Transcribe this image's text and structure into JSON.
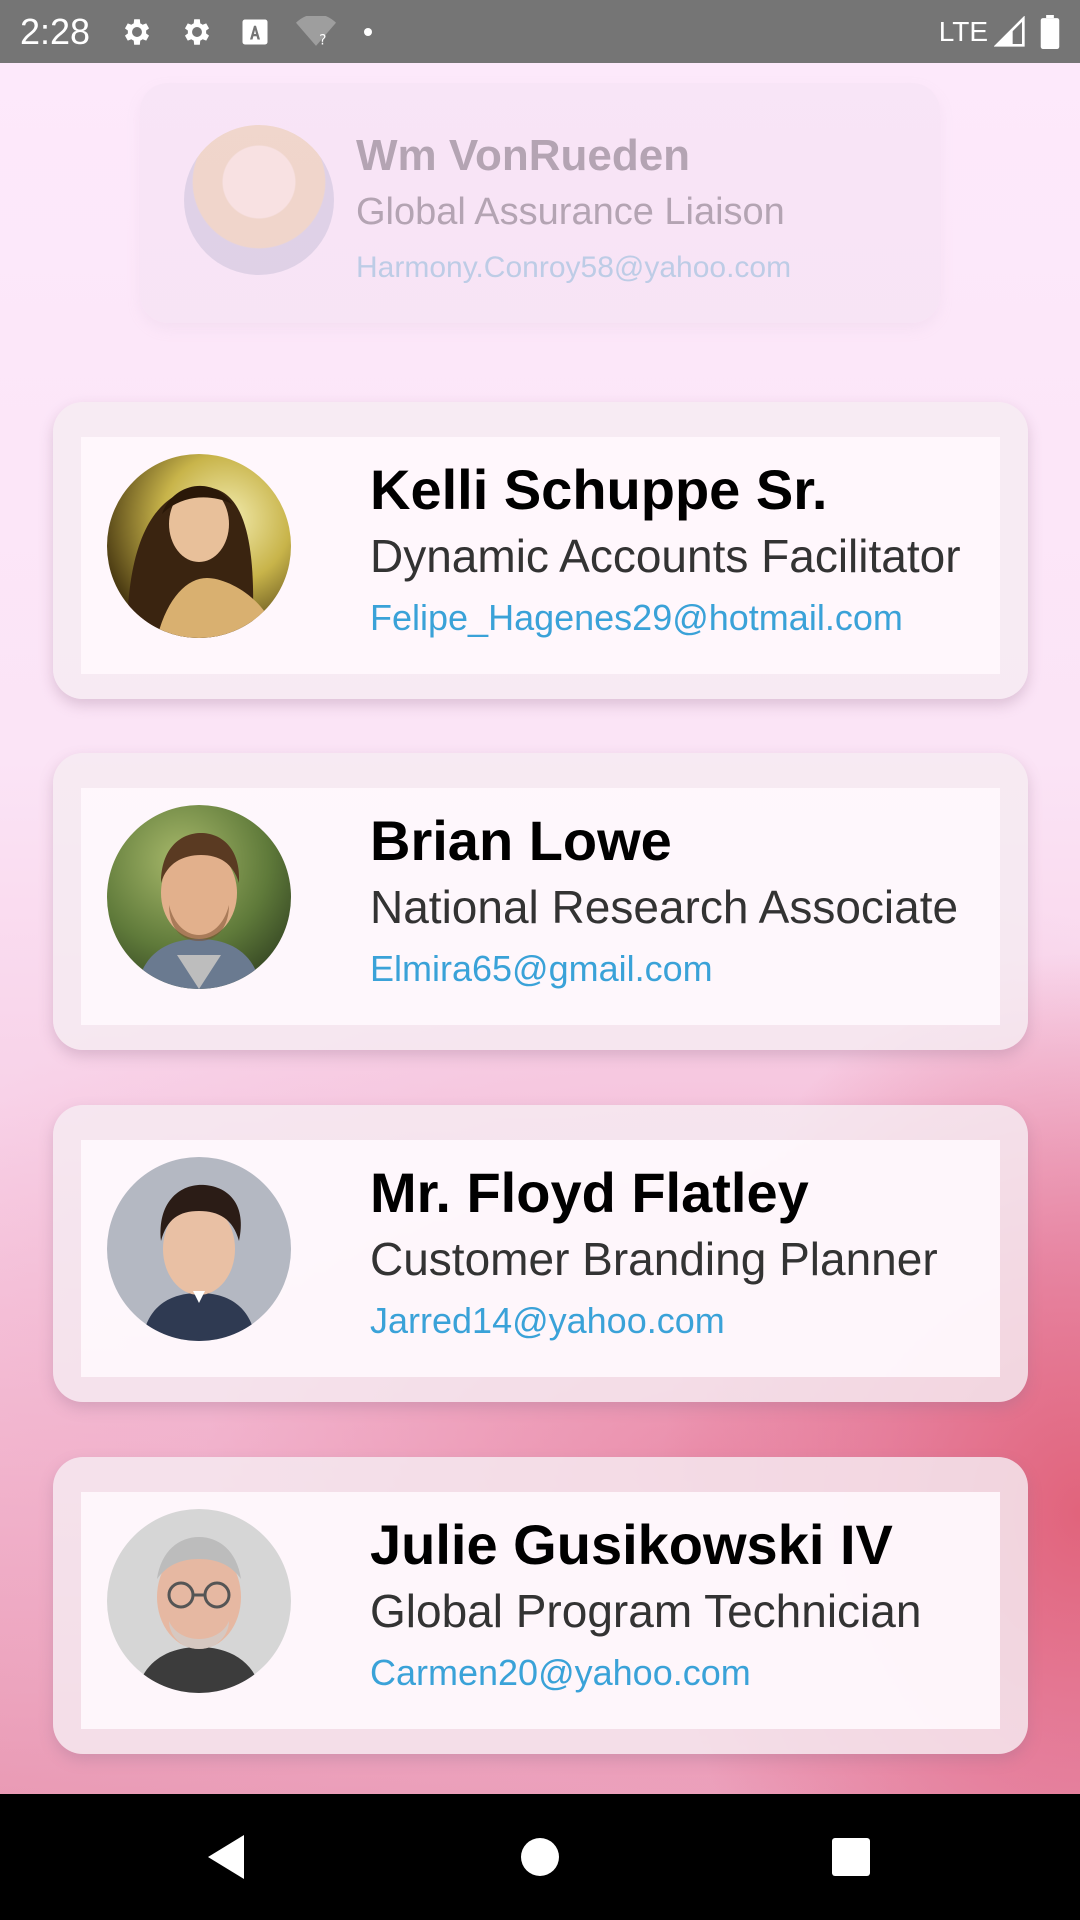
{
  "status_bar": {
    "time": "2:28",
    "icons": [
      "settings-icon",
      "settings-icon",
      "keyboard-a-icon",
      "wifi-unknown-icon",
      "dot-icon"
    ],
    "network": "LTE"
  },
  "ghost_card": {
    "name": "Wm VonRueden",
    "title": "Global Assurance Liaison",
    "email": "Harmony.Conroy58@yahoo.com"
  },
  "contacts": [
    {
      "name": "Kelli Schuppe Sr.",
      "title": "Dynamic Accounts Facilitator",
      "email": "Felipe_Hagenes29@hotmail.com"
    },
    {
      "name": "Brian Lowe",
      "title": "National Research Associate",
      "email": "Elmira65@gmail.com"
    },
    {
      "name": "Mr. Floyd Flatley",
      "title": "Customer Branding Planner",
      "email": "Jarred14@yahoo.com"
    },
    {
      "name": "Julie Gusikowski IV",
      "title": "Global Program Technician",
      "email": "Carmen20@yahoo.com"
    }
  ],
  "nav": {
    "back": "back-icon",
    "home": "home-icon",
    "recents": "recents-icon"
  },
  "colors": {
    "status_bar": "#757575",
    "email": "#3aa2d8",
    "nav_bar": "#000000"
  }
}
